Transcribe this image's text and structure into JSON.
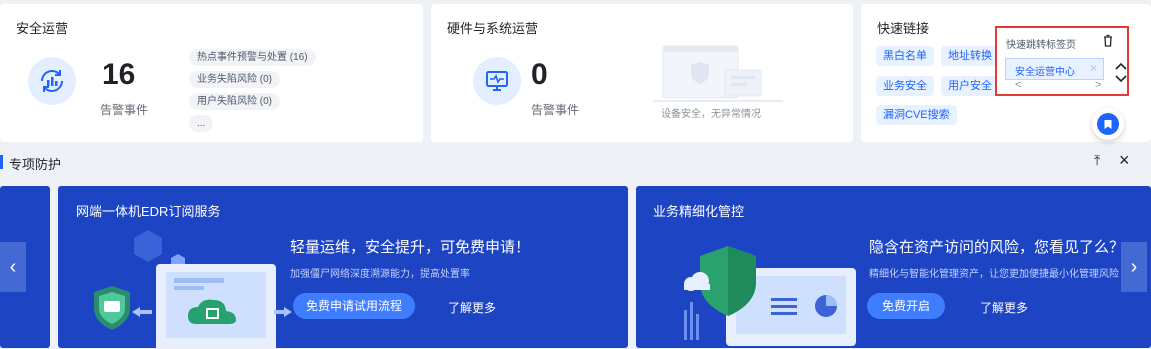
{
  "security_ops": {
    "title": "安全运营",
    "count": "16",
    "count_label": "告警事件",
    "items": [
      "热点事件预警与处置 (16)",
      "业务失陷风险 (0)",
      "用户失陷风险 (0)",
      "..."
    ]
  },
  "hardware_ops": {
    "title": "硬件与系统运营",
    "count": "0",
    "count_label": "告警事件",
    "status_text": "设备安全，无异常情况"
  },
  "quick_links": {
    "title": "快速链接",
    "tags": [
      "黑白名单",
      "地址转换",
      "业务安全",
      "用户安全",
      "漏洞CVE搜索"
    ],
    "popup": {
      "title": "快速跳转标签页",
      "tab_label": "安全运营中心",
      "close_glyph": "×",
      "prev_glyph": "<",
      "next_glyph": ">"
    }
  },
  "section": {
    "title": "专项防护",
    "pin_glyph": "⤒",
    "close_glyph": "×"
  },
  "banners": [
    {
      "title": "网端一体机EDR订阅服务",
      "headline": "轻量运维，安全提升，可免费申请！",
      "desc": "加强僵尸网络深度溯源能力，提高处置率",
      "button": "免费申请试用流程",
      "more": "了解更多"
    },
    {
      "title": "业务精细化管控",
      "headline": "隐含在资产访问的风险，您看见了么？",
      "desc": "精细化与智能化管理资产，让您更加便捷最小化管理风险",
      "button": "免费开启",
      "more": "了解更多"
    }
  ],
  "nav": {
    "prev": "‹",
    "next": "›"
  },
  "colors": {
    "accent": "#1e64ff",
    "banner_bg": "#1d44c3",
    "alert_red": "#e53935"
  }
}
